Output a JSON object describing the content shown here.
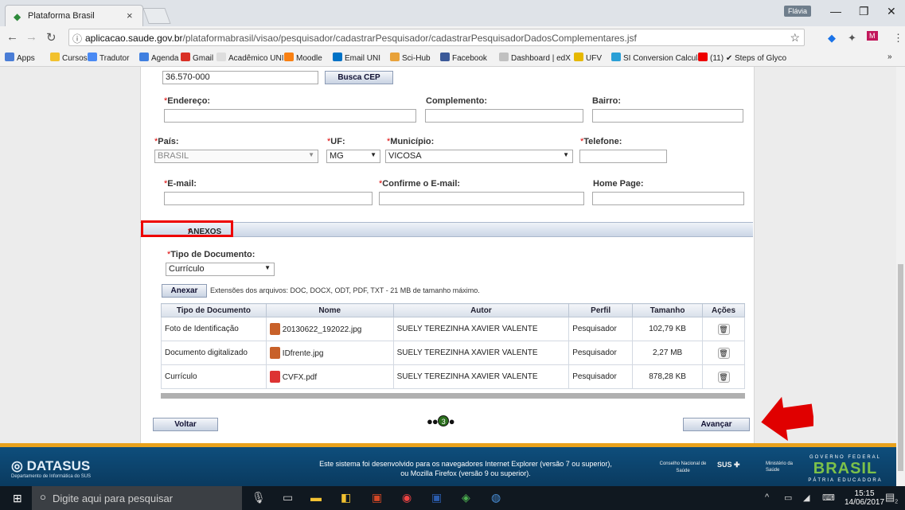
{
  "browser": {
    "tab_title": "Plataforma Brasil",
    "tab_close": "×",
    "user": "Flávia",
    "url_host": "aplicacao.saude.gov.br",
    "url_path": "/plataformabrasil/visao/pesquisador/cadastrarPesquisador/cadastrarPesquisadorDadosComplementares.jsf",
    "bookmarks": [
      "Apps",
      "Cursos",
      "Tradutor",
      "Agenda",
      "Gmail",
      "Acadêmico UNI",
      "Moodle",
      "Email UNI",
      "Sci-Hub",
      "Facebook",
      "Dashboard | edX",
      "UFV",
      "SI Conversion Calcula",
      "(11) ✔ Steps of Glyco"
    ],
    "bookmarks_more": "»"
  },
  "form": {
    "cep_value": "36.570-000",
    "busca_cep": "Busca CEP",
    "endereco_label": "Endereço:",
    "complemento_label": "Complemento:",
    "bairro_label": "Bairro:",
    "pais_label": "País:",
    "pais_value": "BRASIL",
    "uf_label": "UF:",
    "uf_value": "MG",
    "municipio_label": "Município:",
    "municipio_value": "VICOSA",
    "telefone_label": "Telefone:",
    "email_label": "E-mail:",
    "confirme_label": "Confirme o E-mail:",
    "homepage_label": "Home Page:",
    "required_mark": "*"
  },
  "anexos": {
    "section_title": "ANEXOS",
    "tipo_label": "Tipo de Documento:",
    "tipo_value": "Currículo",
    "anexar": "Anexar",
    "extensions": "Extensões dos arquivos: DOC, DOCX, ODT, PDF, TXT - 21 MB de tamanho máximo.",
    "columns": [
      "Tipo de Documento",
      "Nome",
      "Autor",
      "Perfil",
      "Tamanho",
      "Ações"
    ],
    "rows": [
      {
        "tipo": "Foto de Identificação",
        "nome": "20130622_192022.jpg",
        "autor": "SUELY TEREZINHA XAVIER VALENTE",
        "perfil": "Pesquisador",
        "tamanho": "102,79 KB"
      },
      {
        "tipo": "Documento digitalizado",
        "nome": "IDfrente.jpg",
        "autor": "SUELY TEREZINHA XAVIER VALENTE",
        "perfil": "Pesquisador",
        "tamanho": "2,27 MB"
      },
      {
        "tipo": "Currículo",
        "nome": "CVFX.pdf",
        "autor": "SUELY TEREZINHA XAVIER VALENTE",
        "perfil": "Pesquisador",
        "tamanho": "878,28 KB"
      }
    ]
  },
  "nav": {
    "voltar": "Voltar",
    "avancar": "Avançar",
    "current_step": "3"
  },
  "footer": {
    "logo": "DATASUS",
    "logo_sub": "Departamento de Informática do SUS",
    "text1": "Este sistema foi desenvolvido para os navegadores Internet Explorer (versão 7 ou superior),",
    "text2": "ou Mozilla Firefox (versão 9 ou superior).",
    "conselho": "Conselho Nacional de Saúde",
    "sus": "SUS",
    "ministerio": "Ministério da Saúde",
    "gov_top": "GOVERNO FEDERAL",
    "brasil": "BRASIL",
    "gov_bottom": "PÁTRIA EDUCADORA"
  },
  "taskbar": {
    "search_placeholder": "Digite aqui para pesquisar",
    "time": "15:15",
    "date": "14/06/2017",
    "notif_count": "2"
  },
  "colors": {
    "highlight": "#e00000",
    "arrow": "#e00000",
    "footer_bg": "#0e4e7c",
    "footer_stripe": "#e9a21c"
  }
}
